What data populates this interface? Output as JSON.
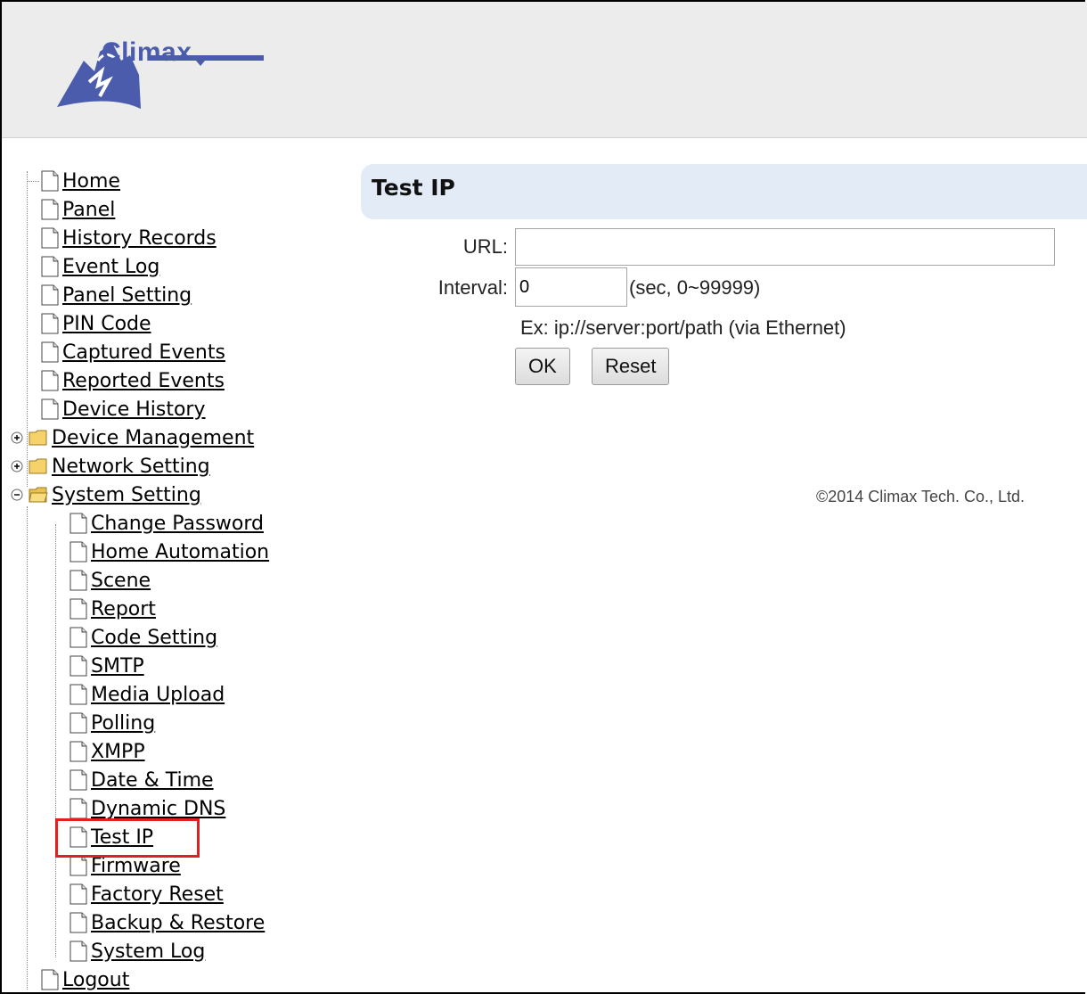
{
  "brand": {
    "name": "Climax"
  },
  "nav": {
    "items": [
      {
        "label": "Home"
      },
      {
        "label": "Panel"
      },
      {
        "label": "History Records"
      },
      {
        "label": "Event Log"
      },
      {
        "label": "Panel Setting"
      },
      {
        "label": "PIN Code"
      },
      {
        "label": "Captured Events"
      },
      {
        "label": "Reported Events"
      },
      {
        "label": "Device History"
      }
    ],
    "folders": [
      {
        "label": "Device Management",
        "expanded": false
      },
      {
        "label": "Network Setting",
        "expanded": false
      },
      {
        "label": "System Setting",
        "expanded": true
      }
    ],
    "system_children": [
      {
        "label": "Change Password"
      },
      {
        "label": "Home Automation"
      },
      {
        "label": "Scene"
      },
      {
        "label": "Report"
      },
      {
        "label": "Code Setting"
      },
      {
        "label": "SMTP"
      },
      {
        "label": "Media Upload"
      },
      {
        "label": "Polling"
      },
      {
        "label": "XMPP"
      },
      {
        "label": "Date & Time"
      },
      {
        "label": "Dynamic DNS"
      },
      {
        "label": "Test IP",
        "selected": true
      },
      {
        "label": "Firmware"
      },
      {
        "label": "Factory Reset"
      },
      {
        "label": "Backup & Restore"
      },
      {
        "label": "System Log"
      }
    ],
    "logout": {
      "label": "Logout"
    }
  },
  "page": {
    "title": "Test IP",
    "url_label": "URL:",
    "url_value": "",
    "interval_label": "Interval:",
    "interval_value": "0",
    "interval_hint": "(sec, 0~99999)",
    "example": "Ex: ip://server:port/path (via Ethernet)",
    "ok_label": "OK",
    "reset_label": "Reset"
  },
  "footer": {
    "copyright": "©2014 Climax Tech. Co., Ltd."
  },
  "colors": {
    "title_bar": "#e3ebf6",
    "highlight": "#e02020",
    "brand": "#4a5cab"
  }
}
